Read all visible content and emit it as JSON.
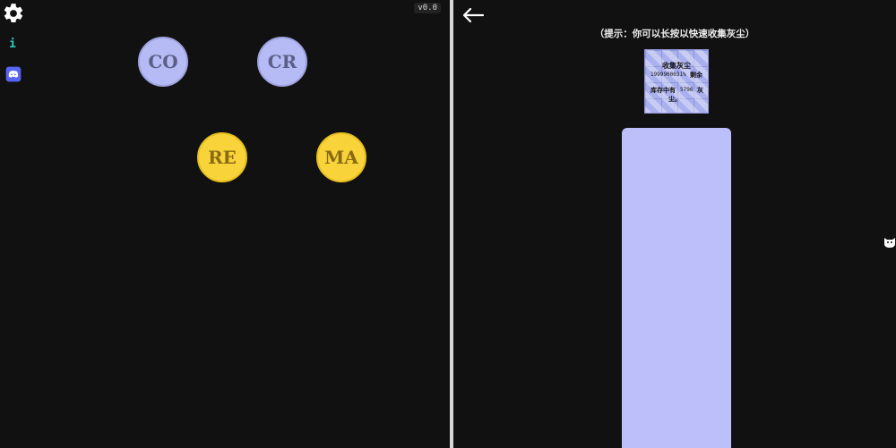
{
  "left": {
    "version": "v0.0",
    "coins": [
      {
        "label": "CO"
      },
      {
        "label": "CR"
      },
      {
        "label": "RE"
      },
      {
        "label": "MA"
      }
    ]
  },
  "right": {
    "hint": "（提示：你可以长按以快速收集灰尘）",
    "card": {
      "title": "收集灰尘",
      "count": "1999900031%",
      "remain_label": "剩余",
      "stock_label": "库存中有",
      "stock_value": "5796",
      "unit_part1": "灰",
      "unit_part2": "尘。"
    }
  },
  "icons": {
    "settings": "gear-icon",
    "info": "info-icon",
    "discord": "discord-icon",
    "back": "back-arrow-icon",
    "cat": "cat-icon"
  },
  "colors": {
    "background": "#111111",
    "coin_blue": "#b6bbf6",
    "coin_gold": "#f8d33a",
    "dust_bar": "#bcbffa",
    "info_icon": "#2ad1c4"
  }
}
